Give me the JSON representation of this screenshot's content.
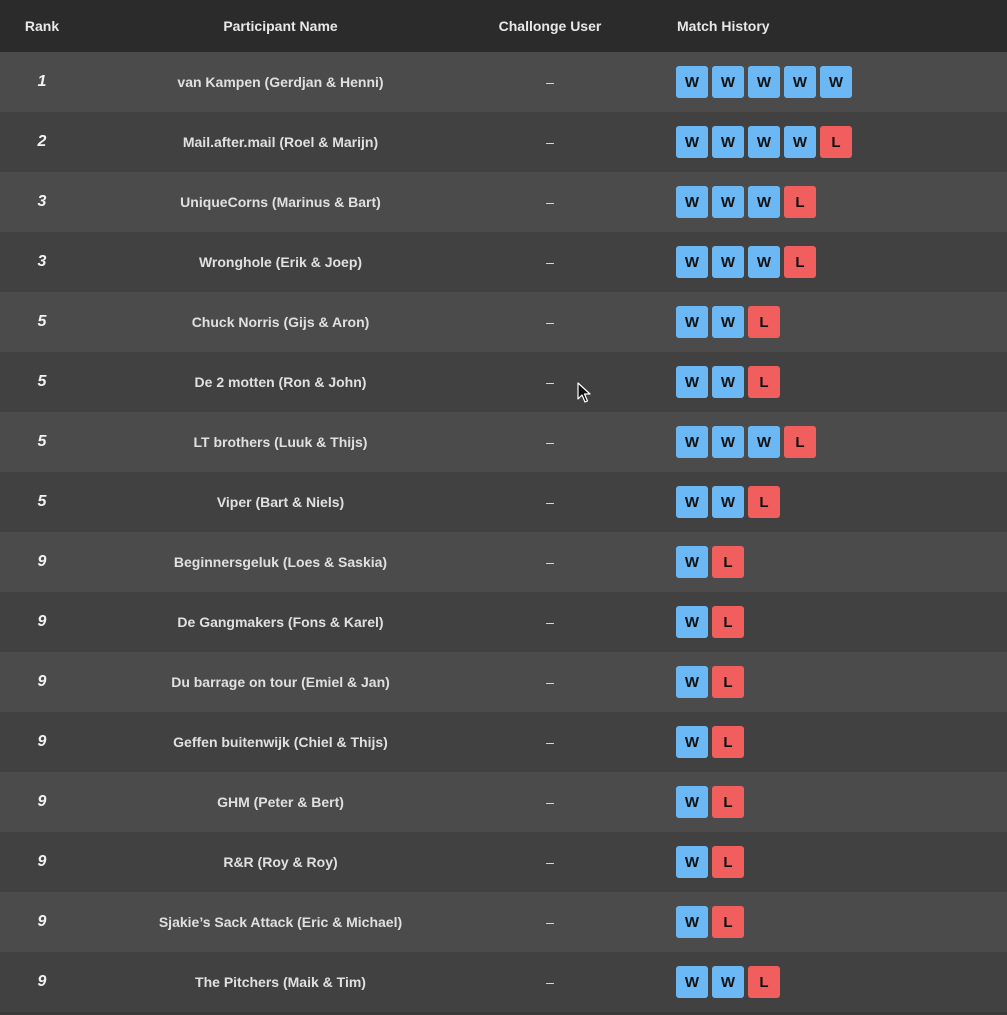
{
  "headers": {
    "rank": "Rank",
    "name": "Participant Name",
    "user": "Challonge User",
    "history": "Match History"
  },
  "colors": {
    "win": "#6bb8f5",
    "loss": "#f15e5e",
    "header_bg": "#2b2b2b"
  },
  "rows": [
    {
      "rank": "1",
      "name": "van Kampen (Gerdjan & Henni)",
      "user": "–",
      "history": [
        "W",
        "W",
        "W",
        "W",
        "W"
      ]
    },
    {
      "rank": "2",
      "name": "Mail.after.mail (Roel & Marijn)",
      "user": "–",
      "history": [
        "W",
        "W",
        "W",
        "W",
        "L"
      ]
    },
    {
      "rank": "3",
      "name": "UniqueCorns (Marinus & Bart)",
      "user": "–",
      "history": [
        "W",
        "W",
        "W",
        "L"
      ]
    },
    {
      "rank": "3",
      "name": "Wronghole (Erik & Joep)",
      "user": "–",
      "history": [
        "W",
        "W",
        "W",
        "L"
      ]
    },
    {
      "rank": "5",
      "name": "Chuck Norris (Gijs & Aron)",
      "user": "–",
      "history": [
        "W",
        "W",
        "L"
      ]
    },
    {
      "rank": "5",
      "name": "De 2 motten (Ron & John)",
      "user": "–",
      "history": [
        "W",
        "W",
        "L"
      ]
    },
    {
      "rank": "5",
      "name": "LT brothers (Luuk & Thijs)",
      "user": "–",
      "history": [
        "W",
        "W",
        "W",
        "L"
      ]
    },
    {
      "rank": "5",
      "name": "Viper (Bart & Niels)",
      "user": "–",
      "history": [
        "W",
        "W",
        "L"
      ]
    },
    {
      "rank": "9",
      "name": "Beginnersgeluk (Loes & Saskia)",
      "user": "–",
      "history": [
        "W",
        "L"
      ]
    },
    {
      "rank": "9",
      "name": "De Gangmakers (Fons & Karel)",
      "user": "–",
      "history": [
        "W",
        "L"
      ]
    },
    {
      "rank": "9",
      "name": "Du barrage on tour (Emiel & Jan)",
      "user": "–",
      "history": [
        "W",
        "L"
      ]
    },
    {
      "rank": "9",
      "name": "Geffen buitenwijk (Chiel & Thijs)",
      "user": "–",
      "history": [
        "W",
        "L"
      ]
    },
    {
      "rank": "9",
      "name": "GHM (Peter & Bert)",
      "user": "–",
      "history": [
        "W",
        "L"
      ]
    },
    {
      "rank": "9",
      "name": "R&R (Roy & Roy)",
      "user": "–",
      "history": [
        "W",
        "L"
      ]
    },
    {
      "rank": "9",
      "name": "Sjakie’s Sack Attack (Eric & Michael)",
      "user": "–",
      "history": [
        "W",
        "L"
      ]
    },
    {
      "rank": "9",
      "name": "The Pitchers (Maik & Tim)",
      "user": "–",
      "history": [
        "W",
        "W",
        "L"
      ]
    }
  ]
}
